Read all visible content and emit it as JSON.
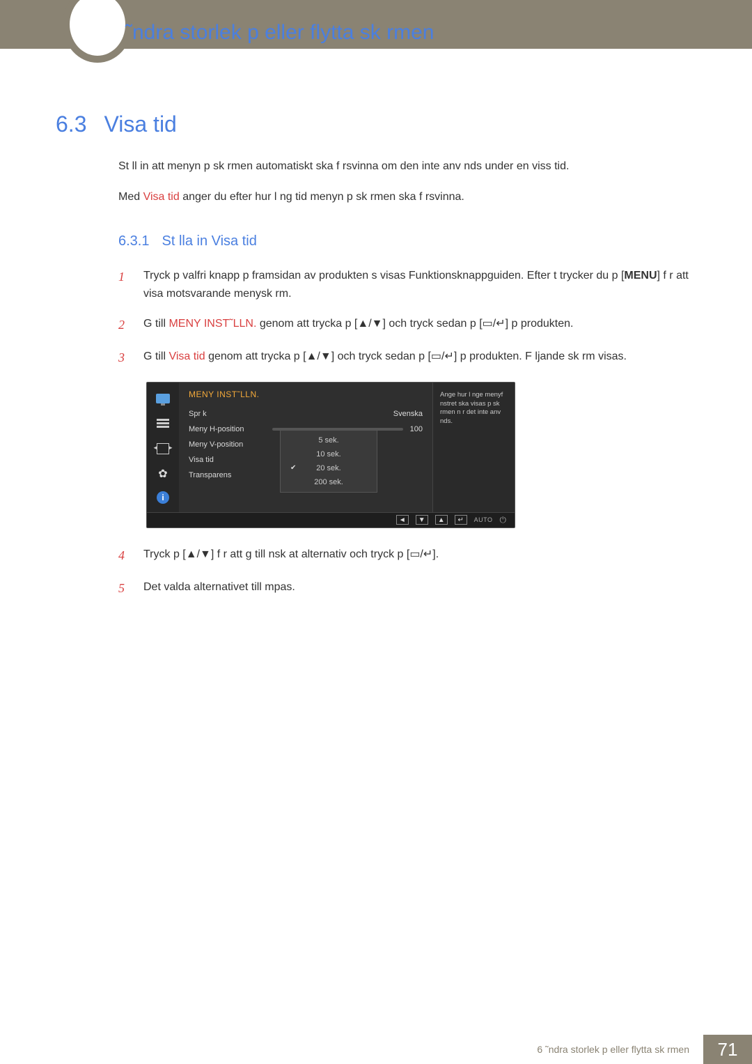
{
  "chapter": {
    "title": "˜ndra storlek p  eller flytta sk rmen"
  },
  "section": {
    "number": "6.3",
    "title": "Visa tid",
    "intro1": "St ll in att menyn p  sk rmen automatiskt ska f rsvinna om den inte anv nds under en viss tid.",
    "intro2_pre": "Med ",
    "intro2_kw": "Visa tid",
    "intro2_post": "  anger du efter hur l ng tid menyn p  sk rmen ska f rsvinna."
  },
  "subsection": {
    "number": "6.3.1",
    "title": "St lla in Visa tid"
  },
  "steps": {
    "s1_num": "1",
    "s1_a": "Tryck p  valfri knapp p  framsidan av produkten s  visas Funktionsknappguiden. Efter t trycker du p  [",
    "s1_menu": "MENU",
    "s1_b": "] f r att visa  motsvarande menysk rm.",
    "s2_num": "2",
    "s2_a": "G  till ",
    "s2_kw": "MENY INST˜LLN.",
    "s2_b": "  genom att trycka p  [",
    "s2_c": "] och tryck sedan p  [",
    "s2_d": "] p  produkten.",
    "s3_num": "3",
    "s3_a": "G  till ",
    "s3_kw": "Visa tid",
    "s3_b": " genom att trycka p  [",
    "s3_c": "] och tryck sedan p  [",
    "s3_d": "] p  produkten. F ljande sk rm visas.",
    "s4_num": "4",
    "s4_a": "Tryck p  [",
    "s4_b": "] f r att g  till  nsk  at alternativ och tryck p  [",
    "s4_c": "].",
    "s5_num": "5",
    "s5_a": "Det valda alternativet till mpas."
  },
  "osd": {
    "heading": "MENY INST˜LLN.",
    "row_sprak_label": "Spr k",
    "row_sprak_value": "Svenska",
    "row_hpos_label": "Meny H-position",
    "row_hpos_value": "100",
    "row_vpos_label": "Meny V-position",
    "row_visa_label": "Visa tid",
    "row_trans_label": "Transparens",
    "opt1": "5 sek.",
    "opt2": "10 sek.",
    "opt3": "20 sek.",
    "opt4": "200 sek.",
    "help": "Ange hur l nge menyf nstret ska visas p  sk rmen n r det inte anv nds.",
    "auto_label": "AUTO"
  },
  "glyphs": {
    "updown": "▲/▼",
    "nav_enter": "▭/↵"
  },
  "footer": {
    "text": "6 ˜ndra storlek p  eller flytta sk rmen",
    "page": "71"
  }
}
